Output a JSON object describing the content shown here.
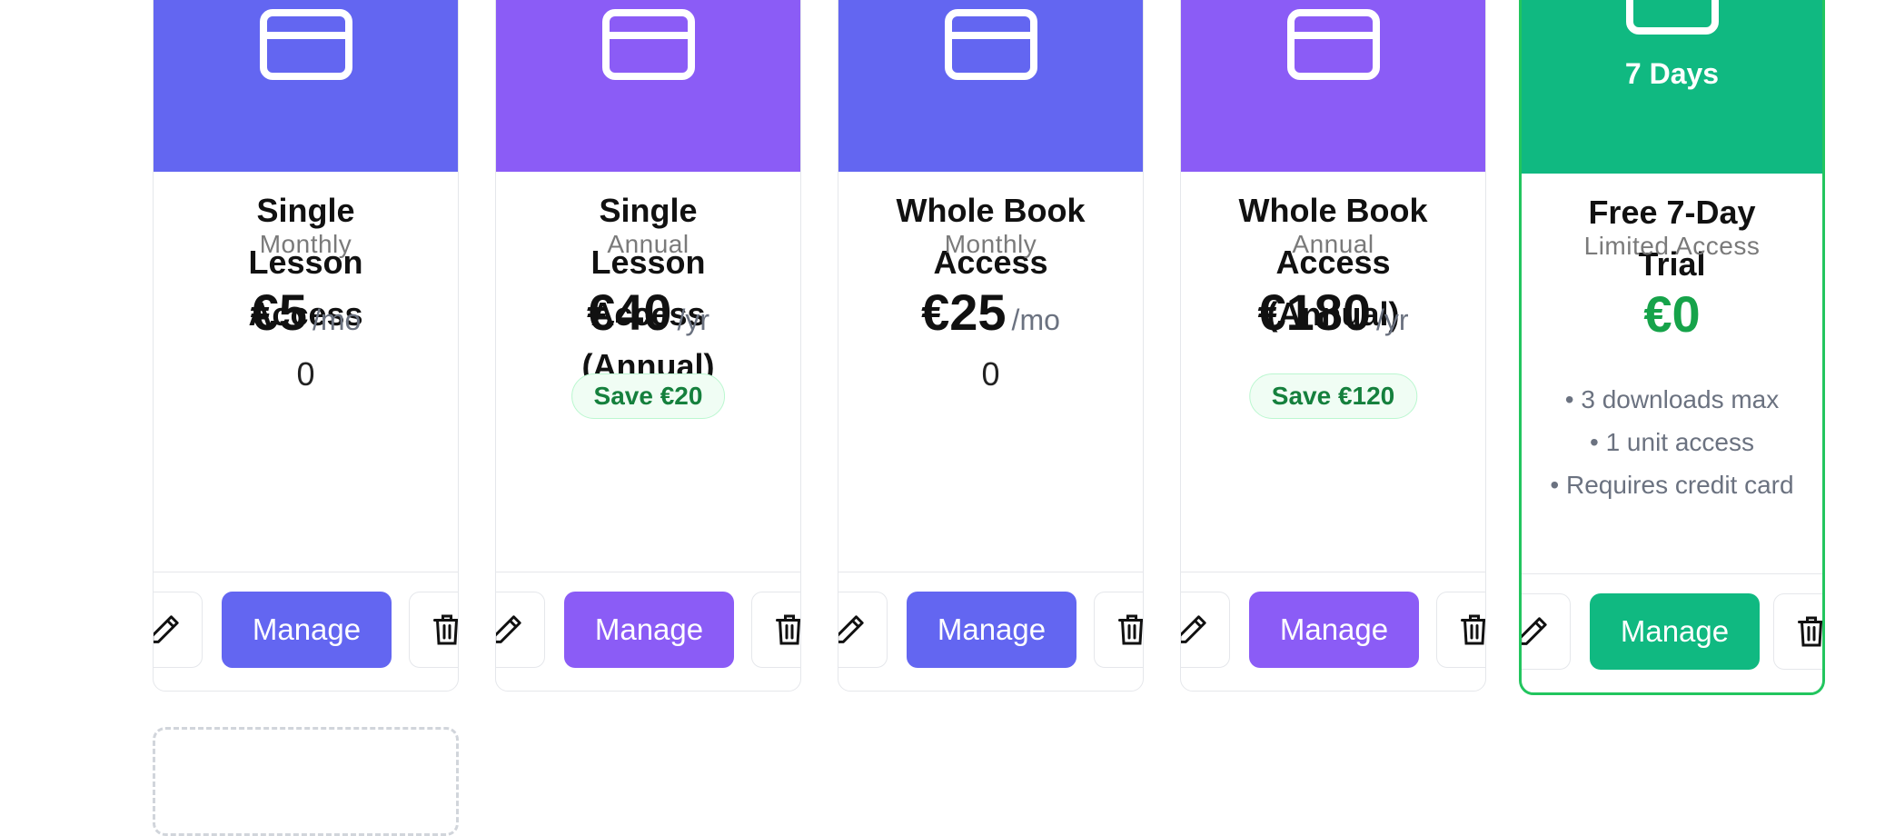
{
  "colors": {
    "indigo": "#6366f1",
    "purple": "#8b5cf6",
    "green": "#10b981",
    "trial_border": "#22c55e"
  },
  "icons": {
    "header": "credit-card-icon",
    "edit": "pencil-icon",
    "delete": "trash-icon"
  },
  "plans": [
    {
      "name": "Single Lesson Access",
      "period": "Monthly",
      "price": "€5",
      "unit": "/mo",
      "sub_value": "0",
      "manage": "Manage",
      "color": "indigo"
    },
    {
      "name": "Single Lesson Access (Annual)",
      "period": "Annual",
      "price": "€40",
      "unit": "/yr",
      "badge": "Save €20",
      "manage": "Manage",
      "color": "purple"
    },
    {
      "name": "Whole Book Access",
      "period": "Monthly",
      "price": "€25",
      "unit": "/mo",
      "sub_value": "0",
      "manage": "Manage",
      "color": "indigo"
    },
    {
      "name": "Whole Book Access (Annual)",
      "period": "Annual",
      "price": "€180",
      "unit": "/yr",
      "badge": "Save €120",
      "manage": "Manage",
      "color": "purple"
    },
    {
      "name": "Free 7-Day Trial",
      "period": "Limited Access",
      "price": "€0",
      "header_label": "7 Days",
      "manage": "Manage",
      "color": "green",
      "features": [
        "3 downloads max",
        "1 unit access",
        "Requires credit card"
      ]
    }
  ]
}
